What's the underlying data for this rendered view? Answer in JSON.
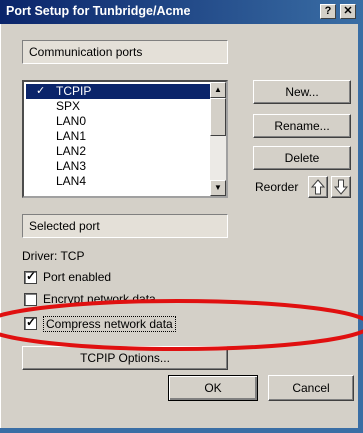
{
  "window": {
    "title": "Port Setup for Tunbridge/Acme",
    "help_label": "?",
    "close_label": "✕"
  },
  "comm_ports": {
    "header": "Communication ports",
    "items": [
      {
        "label": "TCPIP",
        "checked": true,
        "selected": true
      },
      {
        "label": "SPX"
      },
      {
        "label": "LAN0"
      },
      {
        "label": "LAN1"
      },
      {
        "label": "LAN2"
      },
      {
        "label": "LAN3"
      },
      {
        "label": "LAN4"
      }
    ]
  },
  "buttons": {
    "new": "New...",
    "rename": "Rename...",
    "delete": "Delete",
    "reorder": "Reorder",
    "tcpip_options": "TCPIP Options...",
    "ok": "OK",
    "cancel": "Cancel"
  },
  "selected_port": {
    "header": "Selected port",
    "driver": "Driver: TCP",
    "options": [
      {
        "label": "Port enabled",
        "checked": true
      },
      {
        "label": "Encrypt network data",
        "checked": false
      },
      {
        "label": "Compress network data",
        "checked": true
      }
    ]
  },
  "colors": {
    "annotation": "#e01010",
    "selection": "#0a246a"
  }
}
